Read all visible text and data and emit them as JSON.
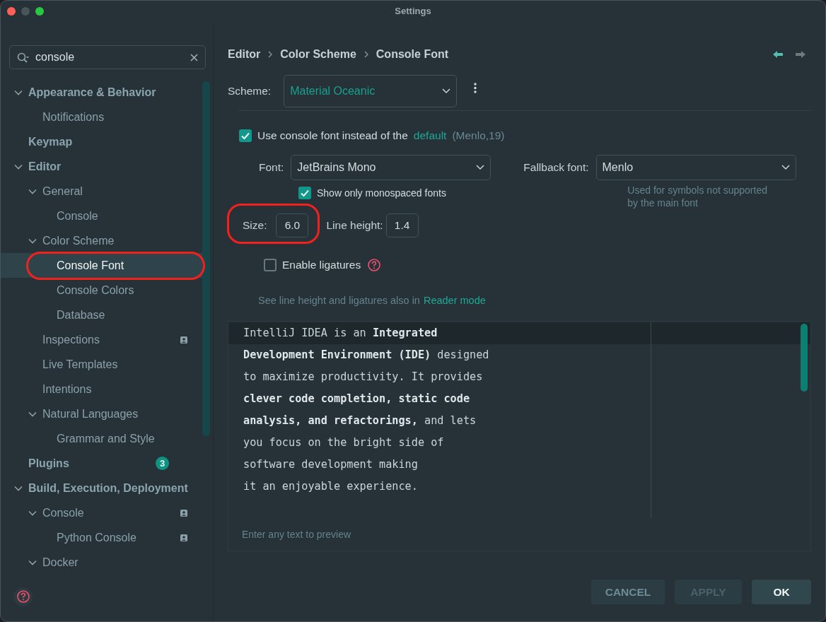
{
  "window": {
    "title": "Settings"
  },
  "search": {
    "value": "console"
  },
  "tree": [
    {
      "label": "Appearance & Behavior",
      "expanded": true,
      "selected": false,
      "scoped": false,
      "children": [
        {
          "label": "Notifications",
          "selected": false,
          "scoped": false
        }
      ]
    },
    {
      "label": "Keymap",
      "selected": false,
      "scoped": false
    },
    {
      "label": "Editor",
      "expanded": true,
      "selected": false,
      "scoped": false,
      "children": [
        {
          "label": "General",
          "expanded": true,
          "selected": false,
          "scoped": false,
          "children": [
            {
              "label": "Console",
              "selected": false,
              "scoped": false
            }
          ]
        },
        {
          "label": "Color Scheme",
          "expanded": true,
          "selected": false,
          "scoped": false,
          "children": [
            {
              "label": "Console Font",
              "selected": true,
              "scoped": false,
              "annotated": true
            },
            {
              "label": "Console Colors",
              "selected": false,
              "scoped": false
            },
            {
              "label": "Database",
              "selected": false,
              "scoped": false
            }
          ]
        },
        {
          "label": "Inspections",
          "selected": false,
          "scoped": true
        },
        {
          "label": "Live Templates",
          "selected": false,
          "scoped": false
        },
        {
          "label": "Intentions",
          "selected": false,
          "scoped": false
        },
        {
          "label": "Natural Languages",
          "expanded": true,
          "selected": false,
          "scoped": false,
          "children": [
            {
              "label": "Grammar and Style",
              "selected": false,
              "scoped": false
            }
          ]
        }
      ]
    },
    {
      "label": "Plugins",
      "selected": false,
      "scoped": false,
      "badge": "3"
    },
    {
      "label": "Build, Execution, Deployment",
      "expanded": true,
      "selected": false,
      "scoped": false,
      "children": [
        {
          "label": "Console",
          "expanded": true,
          "selected": false,
          "scoped": true,
          "children": [
            {
              "label": "Python Console",
              "selected": false,
              "scoped": true
            }
          ]
        },
        {
          "label": "Docker",
          "expanded": true,
          "selected": false,
          "scoped": false
        }
      ]
    }
  ],
  "breadcrumb": [
    "Editor",
    "Color Scheme",
    "Console Font"
  ],
  "nav": {
    "back_enabled": true,
    "forward_enabled": false
  },
  "scheme": {
    "label": "Scheme:",
    "value": "Material Oceanic"
  },
  "use_console_font": {
    "checked": true,
    "text": "Use console font instead of the",
    "link": "default",
    "note": "(Menlo,19)"
  },
  "font": {
    "label": "Font:",
    "value": "JetBrains Mono"
  },
  "fallback_font": {
    "label": "Fallback font:",
    "value": "Menlo",
    "hint_lines": [
      "Used for symbols not supported",
      "by the main font"
    ]
  },
  "monospaced_only": {
    "checked": true,
    "label": "Show only monospaced fonts"
  },
  "size": {
    "label": "Size:",
    "value": "6.0",
    "annotated": true
  },
  "line_height": {
    "label": "Line height:",
    "value": "1.4"
  },
  "ligatures": {
    "checked": false,
    "label": "Enable ligatures"
  },
  "reader_mode": {
    "text": "See line height and ligatures also in",
    "link": "Reader mode"
  },
  "preview": {
    "lines": [
      {
        "text": "IntelliJ IDEA is an **Integrated**",
        "current": true
      },
      {
        "text": "**Development Environment (IDE)** designed",
        "current": false
      },
      {
        "text": "to maximize productivity. It provides",
        "current": false
      },
      {
        "text": "**clever code completion, static code**",
        "current": false
      },
      {
        "text": "**analysis, and refactorings,** and lets",
        "current": false
      },
      {
        "text": "you focus on the bright side of",
        "current": false
      },
      {
        "text": "software development making",
        "current": false
      },
      {
        "text": "it an enjoyable experience.",
        "current": false
      }
    ],
    "hint": "Enter any text to preview"
  },
  "buttons": [
    {
      "label": "CANCEL",
      "disabled": false,
      "default": false
    },
    {
      "label": "APPLY",
      "disabled": true,
      "default": false
    },
    {
      "label": "OK",
      "disabled": false,
      "default": true
    }
  ]
}
